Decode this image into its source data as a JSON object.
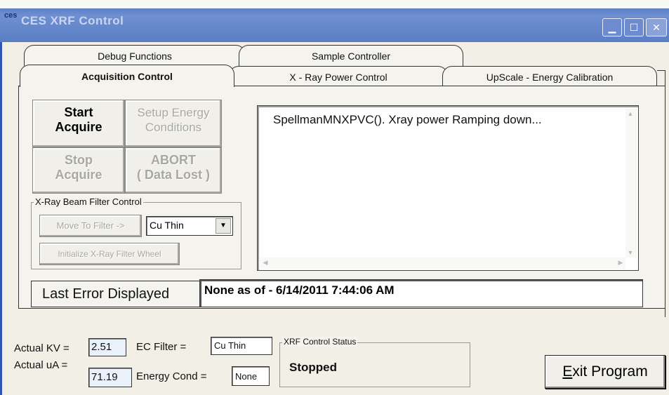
{
  "window": {
    "title": "CES XRF Control",
    "app_icon_text": "ces",
    "controls": [
      "minimize",
      "maximize",
      "close"
    ]
  },
  "tabs": {
    "back_row": [
      {
        "label": "Debug Functions"
      },
      {
        "label": "Sample Controller"
      }
    ],
    "front_row": [
      {
        "label": "Acquisition Control",
        "active": true
      },
      {
        "label": "X - Ray Power Control"
      },
      {
        "label": "UpScale - Energy Calibration"
      }
    ]
  },
  "acquisition": {
    "start_line1": "Start",
    "start_line2": "Acquire",
    "setup_line1": "Setup Energy",
    "setup_line2": "Conditions",
    "stop_line1": "Stop",
    "stop_line2": "Acquire",
    "abort_line1": "ABORT",
    "abort_line2": "( Data Lost )"
  },
  "filter_control": {
    "legend": "X-Ray Beam Filter Control",
    "move_label": "Move To Filter ->",
    "selected_filter": "Cu Thin",
    "init_label": "Initialize X-Ray Filter Wheel"
  },
  "log": {
    "message": "SpellmanMNXPVC(). Xray power Ramping down..."
  },
  "last_error": {
    "label": "Last Error Displayed",
    "value": "None as of - 6/14/2011 7:44:06 AM"
  },
  "status": {
    "actual_kv_label": "Actual KV =",
    "actual_kv_value": "2.51",
    "actual_ua_label": "Actual uA =",
    "actual_ua_value": "71.19",
    "ec_filter_label": "EC Filter =",
    "ec_filter_value": "Cu Thin",
    "energy_cond_label": "Energy Cond =",
    "energy_cond_value": "None",
    "xrf_legend": "XRF Control Status",
    "xrf_status": "Stopped"
  },
  "exit_button": {
    "underline_char": "E",
    "rest": "xit Program"
  },
  "colors": {
    "titlebar": "#5a7ec5",
    "window_bg": "#f4f3ee",
    "value_field_bg": "#eaf1fb"
  }
}
